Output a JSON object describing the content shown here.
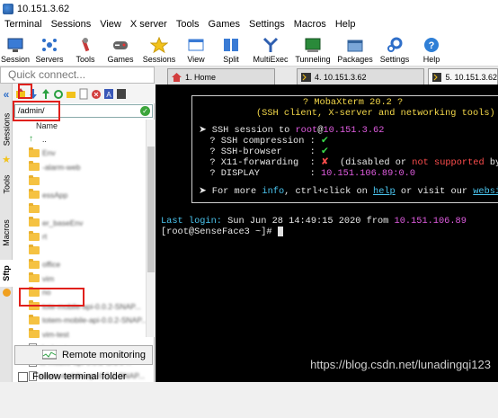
{
  "window": {
    "title": "10.151.3.62"
  },
  "menu": [
    "Terminal",
    "Sessions",
    "View",
    "X server",
    "Tools",
    "Games",
    "Settings",
    "Macros",
    "Help"
  ],
  "toolbar": [
    {
      "label": "Session",
      "icon": "session-icon"
    },
    {
      "label": "Servers",
      "icon": "servers-icon"
    },
    {
      "label": "Tools",
      "icon": "tools-icon"
    },
    {
      "label": "Games",
      "icon": "games-icon"
    },
    {
      "label": "Sessions",
      "icon": "star-icon"
    },
    {
      "label": "View",
      "icon": "view-icon"
    },
    {
      "label": "Split",
      "icon": "split-icon"
    },
    {
      "label": "MultiExec",
      "icon": "multiexec-icon"
    },
    {
      "label": "Tunneling",
      "icon": "tunneling-icon"
    },
    {
      "label": "Packages",
      "icon": "packages-icon"
    },
    {
      "label": "Settings",
      "icon": "gear-icon"
    },
    {
      "label": "Help",
      "icon": "help-icon"
    }
  ],
  "quick_connect": {
    "placeholder": "Quick connect..."
  },
  "tabs": [
    {
      "label": "1. Home",
      "icon": "home-icon"
    },
    {
      "label": "4. 10.151.3.62",
      "icon": "terminal-icon"
    },
    {
      "label": "5. 10.151.3.62",
      "icon": "terminal-icon"
    }
  ],
  "side_tabs": [
    "Sessions",
    "Tools",
    "Macros",
    "Sftp"
  ],
  "sftp": {
    "path": "/admin/",
    "column_header": "Name",
    "files": [
      {
        "name": "..",
        "type": "up"
      },
      {
        "name": "Env",
        "type": "folder",
        "blurred": true
      },
      {
        "name": "-alarm-web",
        "type": "folder",
        "blurred": true
      },
      {
        "name": "",
        "type": "folder",
        "blurred": true
      },
      {
        "name": "essApp",
        "type": "folder",
        "blurred": true
      },
      {
        "name": "",
        "type": "folder",
        "blurred": true
      },
      {
        "name": "er_baseEnv",
        "type": "folder",
        "blurred": true
      },
      {
        "name": "rt",
        "type": "folder",
        "blurred": true
      },
      {
        "name": "",
        "type": "folder",
        "blurred": true
      },
      {
        "name": "office",
        "type": "folder",
        "blurred": true
      },
      {
        "name": "vim",
        "type": "folder",
        "blurred": true
      },
      {
        "name": "no",
        "type": "folder",
        "blurred": true
      },
      {
        "name": "tote-mobile-api-0.0.2-SNAP...",
        "type": "folder",
        "blurred": true
      },
      {
        "name": "totem-mobile-api-0.0.2-SNAP...",
        "type": "folder",
        "blurred": true
      },
      {
        "name": "vim-test",
        "type": "folder",
        "blurred": true
      },
      {
        "name": "docker.tgz",
        "type": "file",
        "blurred": true
      },
      {
        "name": "to-mobile-api-0.0.2-SNAP...",
        "type": "file",
        "blurred": true
      },
      {
        "name": "totem-mobile-api-0.0.2-SNAP...",
        "type": "file",
        "blurred": true
      }
    ],
    "remote_monitoring": "Remote monitoring",
    "follow_folder": "Follow terminal folder"
  },
  "terminal": {
    "banner_title": "? MobaXterm 20.2 ?",
    "banner_subtitle": "(SSH client, X-server and networking tools)",
    "ssh_session_prefix": "➤ SSH session to ",
    "ssh_user": "root",
    "ssh_at": "@",
    "ssh_host": "10.151.3.62",
    "compression_label": "  ? SSH compression : ",
    "compression_value": "✔",
    "browser_label": "  ? SSH-browser     : ",
    "browser_value": "✔",
    "x11_label": "  ? X11-forwarding  : ",
    "x11_value": "✘",
    "x11_note_open": "  (disabled ",
    "x11_note_or": "or ",
    "x11_note_ns": "not supported ",
    "x11_note_end": "by s",
    "display_label": "  ? DISPLAY         : ",
    "display_value": "10.151.106.89:0.0",
    "more_prefix": "➤ For more ",
    "more_info": "info",
    "more_mid": ", ctrl+click on ",
    "more_help": "help",
    "more_mid2": " or visit our ",
    "more_website": "website",
    "last_login_label": "Last login:",
    "last_login_text": " Sun Jun 28 14:49:15 2020 from ",
    "last_login_ip": "10.151.106.89",
    "prompt": "[root@SenseFace3 ~]# ",
    "watermark": "https://blog.csdn.net/lunadingqi123"
  },
  "colors": {
    "highlight_box": "#e0201c",
    "terminal_bg": "#000000",
    "accent_yellow": "#f5d94a",
    "accent_magenta": "#e05ce0",
    "accent_cyan": "#4bc6f0"
  }
}
